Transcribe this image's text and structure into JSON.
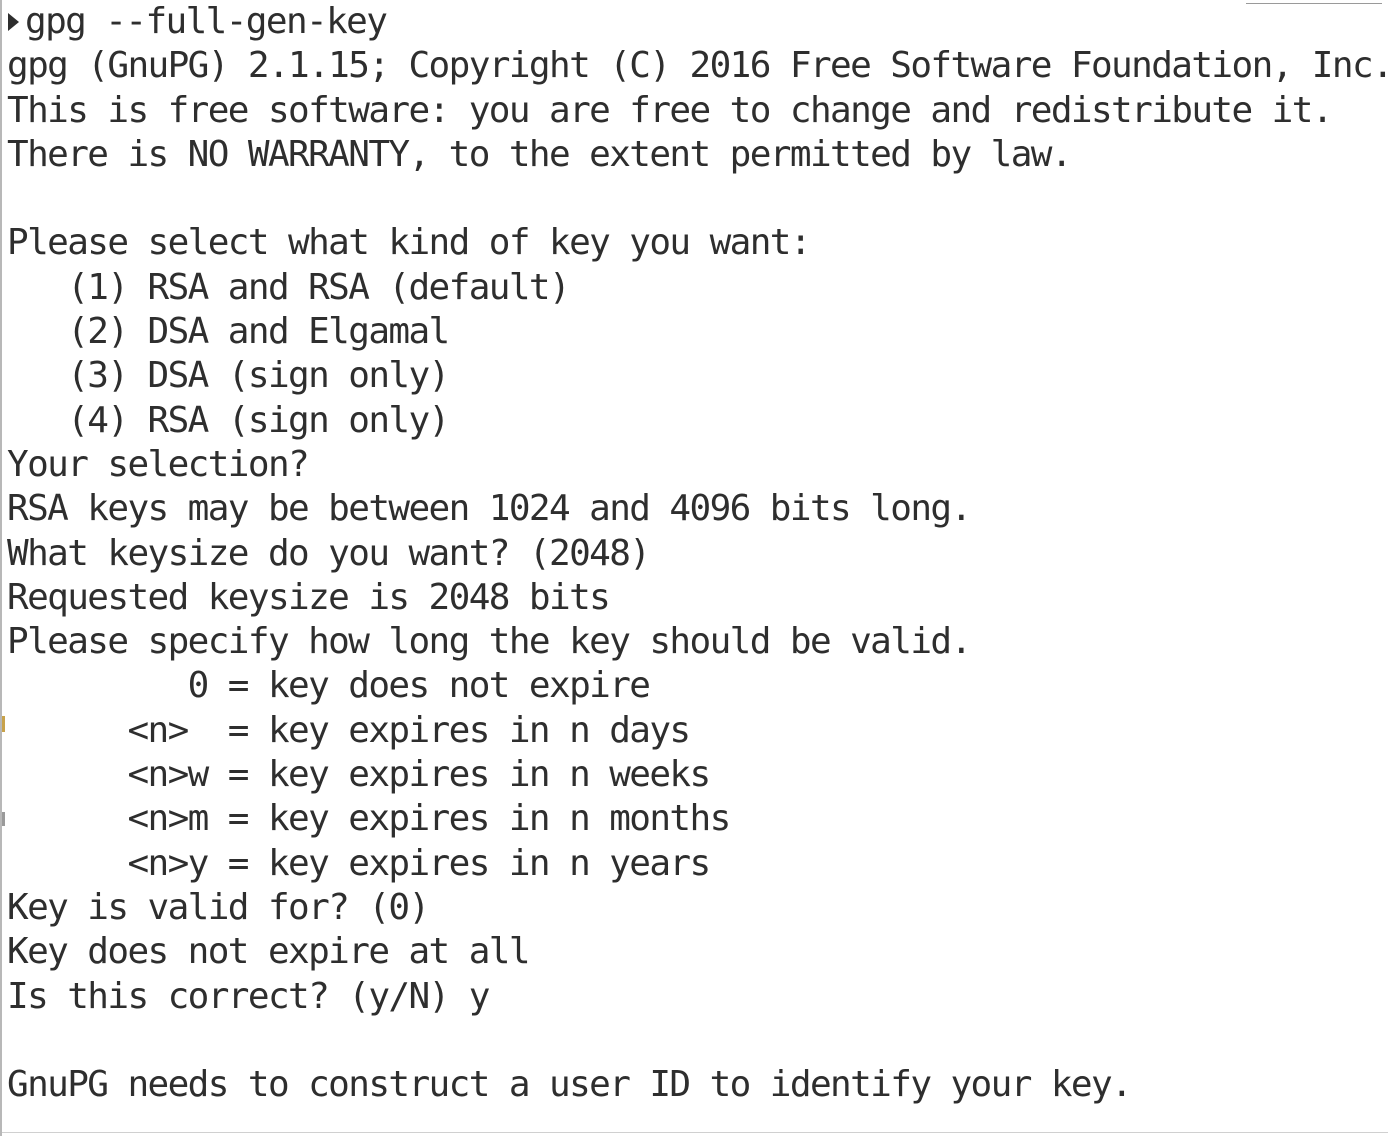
{
  "terminal": {
    "command": "gpg --full-gen-key",
    "output": [
      "gpg (GnuPG) 2.1.15; Copyright (C) 2016 Free Software Foundation, Inc.",
      "This is free software: you are free to change and redistribute it.",
      "There is NO WARRANTY, to the extent permitted by law.",
      "",
      "Please select what kind of key you want:",
      "   (1) RSA and RSA (default)",
      "   (2) DSA and Elgamal",
      "   (3) DSA (sign only)",
      "   (4) RSA (sign only)",
      "Your selection?",
      "RSA keys may be between 1024 and 4096 bits long.",
      "What keysize do you want? (2048)",
      "Requested keysize is 2048 bits",
      "Please specify how long the key should be valid.",
      "         0 = key does not expire",
      "      <n>  = key expires in n days",
      "      <n>w = key expires in n weeks",
      "      <n>m = key expires in n months",
      "      <n>y = key expires in n years",
      "Key is valid for? (0)",
      "Key does not expire at all",
      "Is this correct? (y/N) y",
      "",
      "GnuPG needs to construct a user ID to identify your key."
    ]
  },
  "icons": {
    "prompt": "prompt-triangle-icon"
  }
}
